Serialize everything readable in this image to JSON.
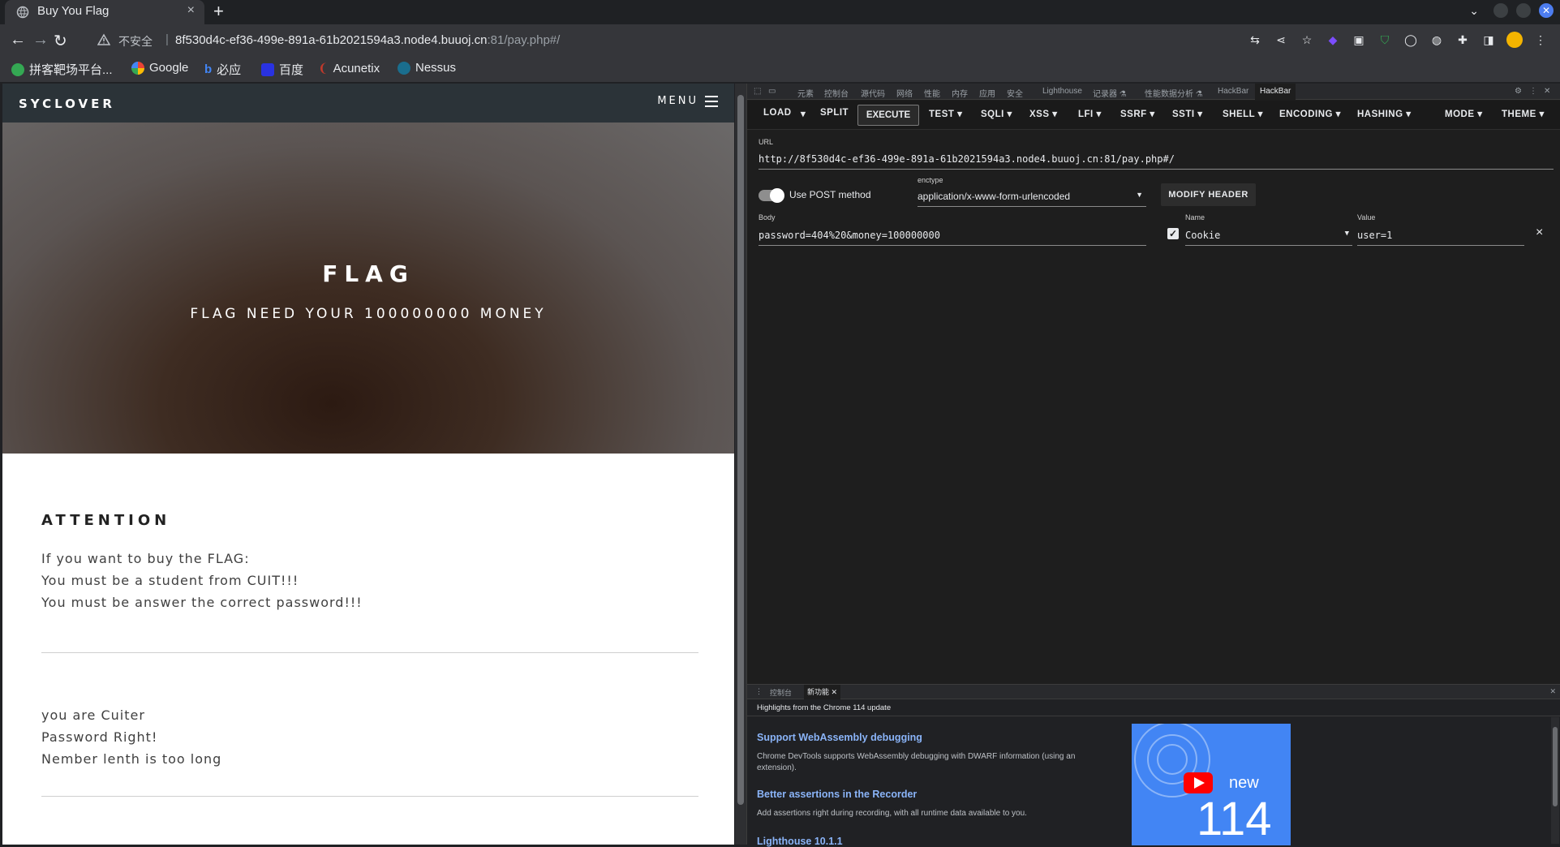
{
  "browser": {
    "tab_title": "Buy You Flag",
    "tab_close": "×",
    "new_tab": "+",
    "insecure_label": "不安全",
    "url_host": "8f530d4c-ef36-499e-891a-61b2021594a3.node4.buuoj.cn",
    "url_rest": ":81/pay.php#/",
    "bookmarks": [
      "拼客靶场平台...",
      "Google",
      "必应",
      "百度",
      "Acunetix",
      "Nessus"
    ],
    "colors": {
      "tab_bg": "#35363a",
      "strip_bg": "#1f2124"
    }
  },
  "site": {
    "brand": "SYCLOVER",
    "menu": "MENU",
    "hero_title": "FLAG",
    "hero_subtitle": "FLAG NEED YOUR 100000000 MONEY",
    "attention_heading": "ATTENTION",
    "attention_lines": [
      "If you want to buy the FLAG:",
      "You must be a student from CUIT!!!",
      "You must be answer the correct password!!!"
    ],
    "result_lines": [
      "you are Cuiter",
      "Password Right!",
      "Nember lenth is too long"
    ]
  },
  "devtools": {
    "tabs": [
      "元素",
      "控制台",
      "源代码",
      "网络",
      "性能",
      "内存",
      "应用",
      "安全",
      "Lighthouse",
      "记录器 ⚗",
      "性能数据分析 ⚗",
      "HackBar",
      "HackBar"
    ],
    "hackbar": {
      "buttons": [
        "LOAD",
        "SPLIT",
        "EXECUTE",
        "TEST ▾",
        "SQLI ▾",
        "XSS ▾",
        "LFI ▾",
        "SSRF ▾",
        "SSTI ▾",
        "SHELL ▾",
        "ENCODING ▾",
        "HASHING ▾",
        "MODE ▾",
        "THEME ▾"
      ],
      "url_label": "URL",
      "url_value": "http://8f530d4c-ef36-499e-891a-61b2021594a3.node4.buuoj.cn:81/pay.php#/",
      "post_toggle_label": "Use POST method",
      "post_enabled": true,
      "enctype_label": "enctype",
      "enctype_value": "application/x-www-form-urlencoded",
      "modify_header": "MODIFY HEADER",
      "body_label": "Body",
      "body_value": "password=404%20&money=100000000",
      "header_name_label": "Name",
      "header_name_value": "Cookie",
      "header_value_label": "Value",
      "header_value_value": "user=1",
      "header_enabled": true,
      "remove": "×"
    },
    "drawer": {
      "tabs": [
        "控制台",
        "新功能"
      ],
      "highlight_title": "Highlights from the Chrome 114 update",
      "items": [
        {
          "heading": "Support WebAssembly debugging",
          "text": "Chrome DevTools supports WebAssembly debugging with DWARF information (using an extension)."
        },
        {
          "heading": "Better assertions in the Recorder",
          "text": "Add assertions right during recording, with all runtime data available to you."
        },
        {
          "heading": "Lighthouse 10.1.1",
          "text": ""
        }
      ],
      "promo_new": "new",
      "promo_version": "114"
    }
  }
}
